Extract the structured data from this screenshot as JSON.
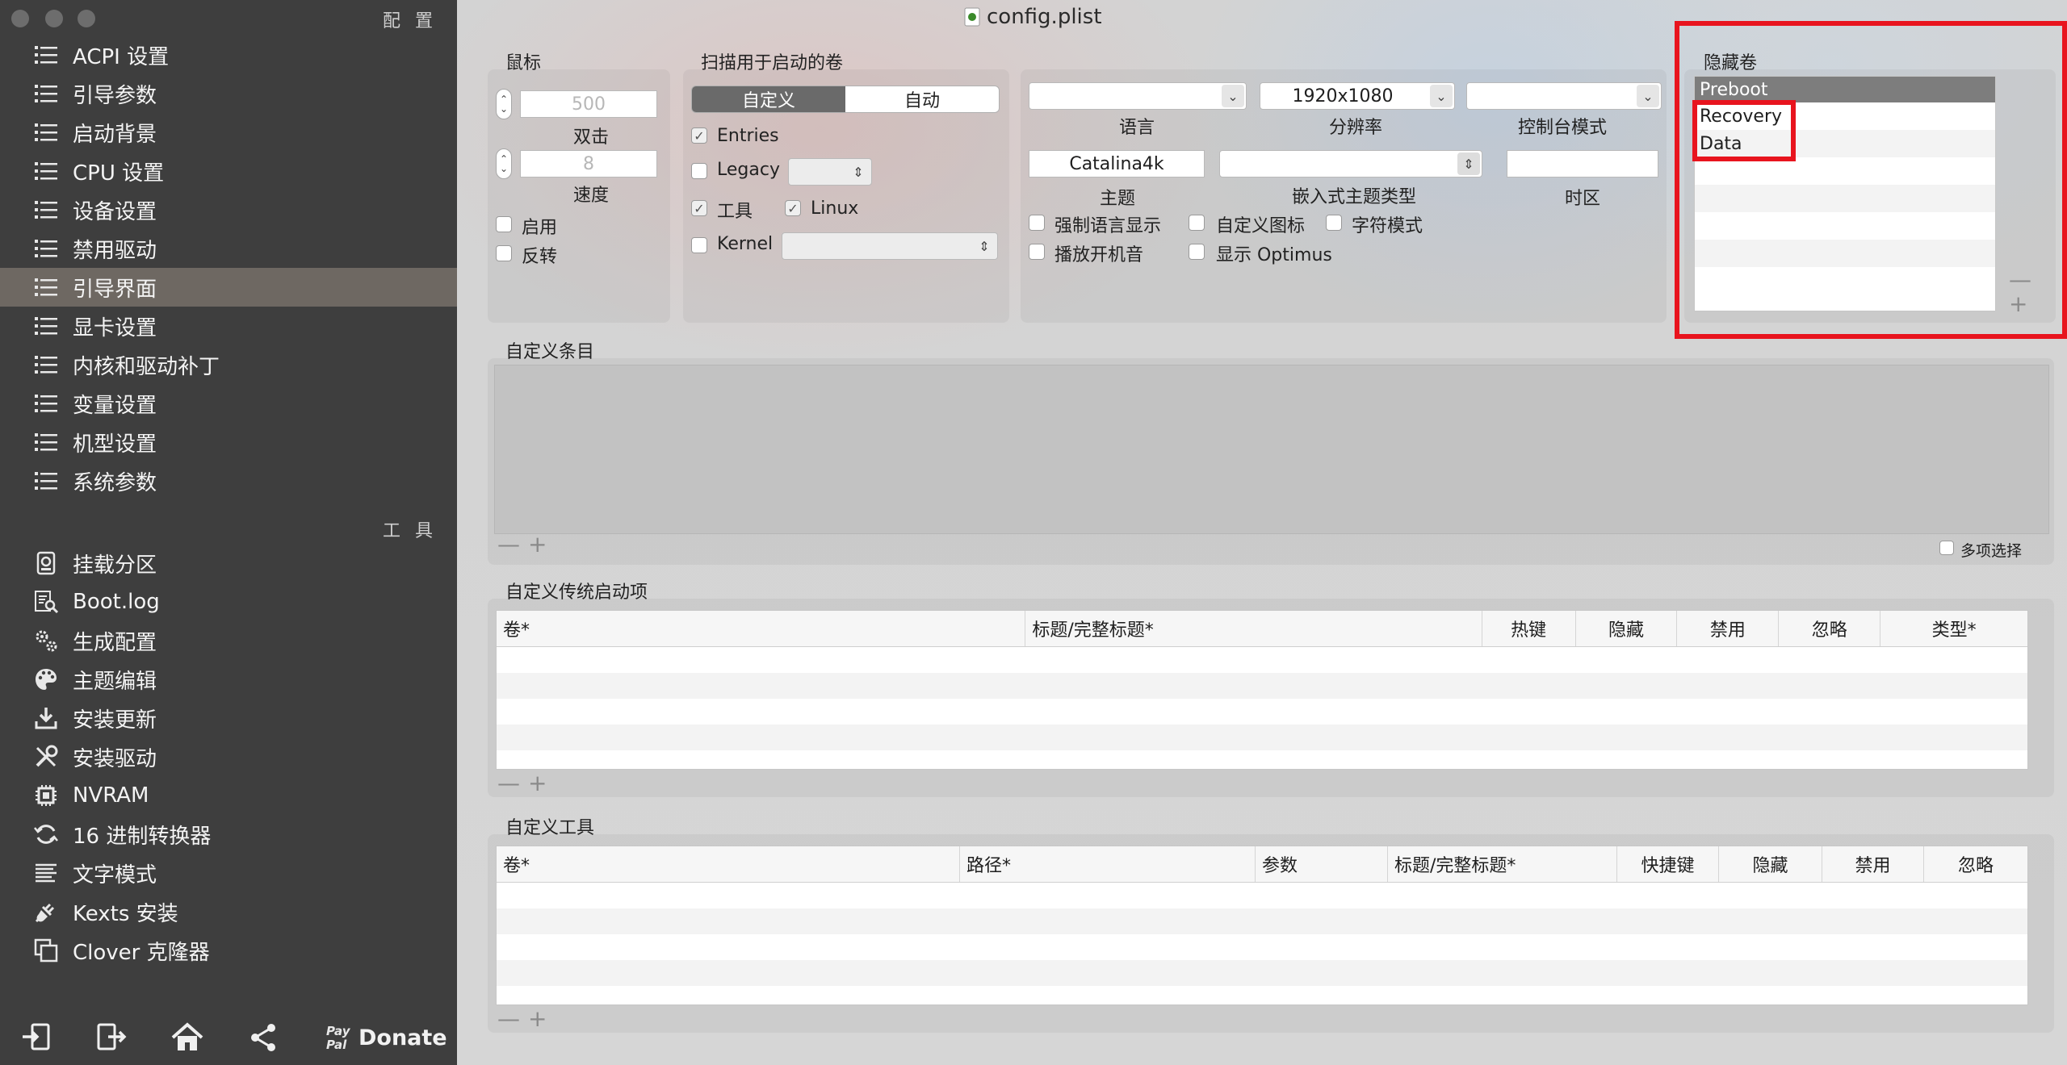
{
  "window": {
    "title": "config.plist"
  },
  "sidebar": {
    "config_header": "配置",
    "tools_header": "工具",
    "items": [
      {
        "label": "ACPI 设置",
        "icon": "list-icon"
      },
      {
        "label": "引导参数",
        "icon": "list-icon"
      },
      {
        "label": "启动背景",
        "icon": "list-icon"
      },
      {
        "label": "CPU 设置",
        "icon": "list-icon"
      },
      {
        "label": "设备设置",
        "icon": "list-icon"
      },
      {
        "label": "禁用驱动",
        "icon": "list-icon"
      },
      {
        "label": "引导界面",
        "icon": "list-icon",
        "selected": true
      },
      {
        "label": "显卡设置",
        "icon": "list-icon"
      },
      {
        "label": "内核和驱动补丁",
        "icon": "list-icon"
      },
      {
        "label": "变量设置",
        "icon": "list-icon"
      },
      {
        "label": "机型设置",
        "icon": "list-icon"
      },
      {
        "label": "系统参数",
        "icon": "list-icon"
      }
    ],
    "tools": [
      {
        "label": "挂载分区",
        "icon": "disk-icon"
      },
      {
        "label": "Boot.log",
        "icon": "log-search-icon"
      },
      {
        "label": "生成配置",
        "icon": "gears-icon"
      },
      {
        "label": "主题编辑",
        "icon": "palette-icon"
      },
      {
        "label": "安装更新",
        "icon": "download-icon"
      },
      {
        "label": "安装驱动",
        "icon": "tools-icon"
      },
      {
        "label": "NVRAM",
        "icon": "chip-icon"
      },
      {
        "label": "16 进制转换器",
        "icon": "refresh-icon"
      },
      {
        "label": "文字模式",
        "icon": "text-lines-icon"
      },
      {
        "label": "Kexts 安装",
        "icon": "plug-icon"
      },
      {
        "label": "Clover 克隆器",
        "icon": "clone-icon"
      }
    ],
    "bottom": {
      "donate_label": "Donate",
      "paypal_text": "Pay Pal"
    }
  },
  "mouse": {
    "section_title": "鼠标",
    "double_click_value": "500",
    "double_click_label": "双击",
    "speed_value": "8",
    "speed_label": "速度",
    "enable_label": "启用",
    "mirror_label": "反转"
  },
  "scan": {
    "section_title": "扫描用于启动的卷",
    "seg_custom": "自定义",
    "seg_auto": "自动",
    "entries_label": "Entries",
    "legacy_label": "Legacy",
    "tool_label": "工具",
    "linux_label": "Linux",
    "kernel_label": "Kernel"
  },
  "gui": {
    "language_label": "语言",
    "resolution_value": "1920x1080",
    "resolution_label": "分辨率",
    "console_label": "控制台模式",
    "theme_value": "Catalina4k",
    "theme_label": "主题",
    "embedded_theme_label": "嵌入式主题类型",
    "timezone_label": "时区",
    "force_lang_label": "强制语言显示",
    "custom_icons_label": "自定义图标",
    "text_mode_label": "字符模式",
    "play_sound_label": "播放开机音",
    "show_optimus_label": "显示 Optimus"
  },
  "hidden": {
    "section_title": "隐藏卷",
    "volumes": [
      "Preboot",
      "Recovery",
      "Data"
    ]
  },
  "custom_entries": {
    "section_title": "自定义条目",
    "multi_select_label": "多项选择"
  },
  "legacy": {
    "section_title": "自定义传统启动项",
    "columns": [
      "卷*",
      "标题/完整标题*",
      "热键",
      "隐藏",
      "禁用",
      "忽略",
      "类型*"
    ]
  },
  "custom_tools": {
    "section_title": "自定义工具",
    "columns": [
      "卷*",
      "路径*",
      "参数",
      "标题/完整标题*",
      "快捷键",
      "隐藏",
      "禁用",
      "忽略"
    ]
  },
  "controls": {
    "minus": "—",
    "plus": "+"
  },
  "colors": {
    "sidebar_bg": "#3e3e3e",
    "selected_item": "#6e6862",
    "highlight": "#e8141e"
  }
}
